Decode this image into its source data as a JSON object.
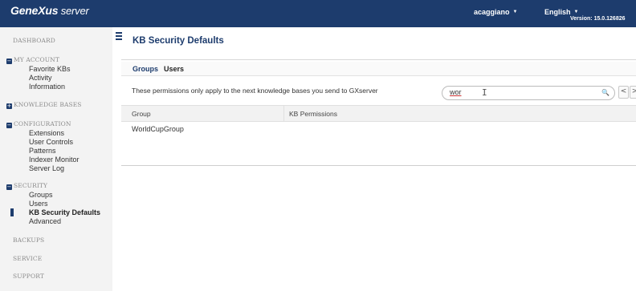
{
  "topbar": {
    "logo_brand": "GeneXus",
    "logo_product": " server",
    "user": "acaggiano",
    "language": "English",
    "version": "Version: 15.0.126826"
  },
  "sidebar": {
    "dashboard": "DASHBOARD",
    "my_account": {
      "title": "MY ACCOUNT",
      "items": [
        "Favorite KBs",
        "Activity",
        "Information"
      ]
    },
    "knowledge_bases": "KNOWLEDGE BASES",
    "configuration": {
      "title": "CONFIGURATION",
      "items": [
        "Extensions",
        "User Controls",
        "Patterns",
        "Indexer Monitor",
        "Server Log"
      ]
    },
    "security": {
      "title": "SECURITY",
      "items": [
        "Groups",
        "Users",
        "KB Security Defaults",
        "Advanced"
      ],
      "active_index": 2
    },
    "backups": "BACKUPS",
    "service": "SERVICE",
    "support": "SUPPORT"
  },
  "main": {
    "title": "KB Security Defaults",
    "tabs": [
      {
        "label": "Groups",
        "active": true
      },
      {
        "label": "Users",
        "active": false
      }
    ],
    "info_text": "These permissions only apply to the next knowledge bases you send to GXserver",
    "search": {
      "value": "wor",
      "placeholder": ""
    },
    "pager": {
      "prev": "<",
      "next": ">"
    },
    "table": {
      "columns": [
        "Group",
        "KB Permissions"
      ],
      "rows": [
        [
          "WorldCupGroup",
          ""
        ]
      ]
    }
  },
  "colors": {
    "brand_navy": "#1d3c6d",
    "sidebar_bg": "#f3f3f3",
    "section_gray": "#8b8b8b"
  },
  "icons": {
    "menu": "hamburger-icon",
    "collapse": "minus-square-icon",
    "expand": "plus-square-icon",
    "search": "magnifier-icon",
    "dropdown": "caret-down-icon"
  }
}
